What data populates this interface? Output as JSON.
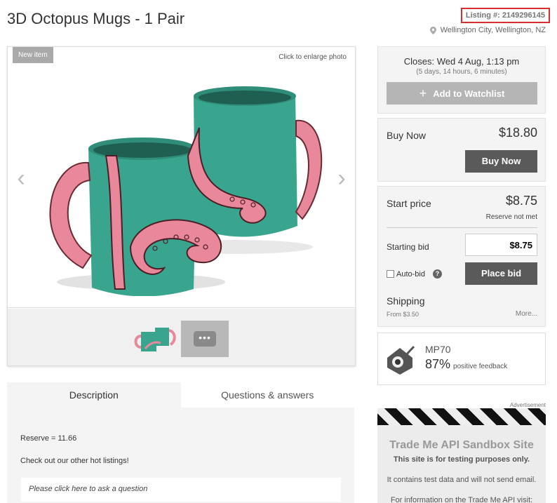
{
  "listing": {
    "title": "3D Octopus Mugs - 1 Pair",
    "listing_number": "Listing #: 2149296145",
    "location": "Wellington City, Wellington, NZ"
  },
  "gallery": {
    "badge": "New item",
    "enlarge_hint": "Click to enlarge photo",
    "prev_icon": "chevron-left-icon",
    "next_icon": "chevron-right-icon",
    "more_thumb_label": "•••"
  },
  "tabs": [
    {
      "label": "Description",
      "active": true
    },
    {
      "label": "Questions & answers",
      "active": false
    }
  ],
  "description": {
    "lines": [
      "Reserve = 11.66",
      "Check out our other hot listings!"
    ],
    "ask_question": "Please click here to ask a question"
  },
  "closing": {
    "closes": "Closes: Wed 4 Aug, 1:13 pm",
    "remaining": "(5 days, 14 hours, 6 minutes)",
    "watchlist_label": "Add to Watchlist"
  },
  "buy_now": {
    "label": "Buy Now",
    "price": "$18.80",
    "button": "Buy Now"
  },
  "bidding": {
    "start_label": "Start price",
    "start_price": "$8.75",
    "reserve_status": "Reserve not met",
    "starting_bid_label": "Starting bid",
    "starting_bid_value": "$8.75",
    "autobid_label": "Auto-bid",
    "autobid_checked": false,
    "help_glyph": "?",
    "place_bid_button": "Place bid",
    "shipping_label": "Shipping",
    "shipping_from": "From $3.50",
    "shipping_more": "More..."
  },
  "seller": {
    "name": "MP70",
    "feedback_pct": "87%",
    "feedback_text": "positive feedback"
  },
  "ad": {
    "label": "Advertisement",
    "title": "Trade Me API Sandbox Site",
    "line1": "This site is for testing purposes only.",
    "line2": "It contains test data and will not send email.",
    "line3": "For information on the Trade Me API visit:"
  },
  "colors": {
    "highlight_border": "#d62f2f",
    "button_dark": "#5a5a5a",
    "button_disabled": "#b5b5b5",
    "mug_teal": "#3aa58e",
    "tentacle_pink": "#e8889a"
  }
}
